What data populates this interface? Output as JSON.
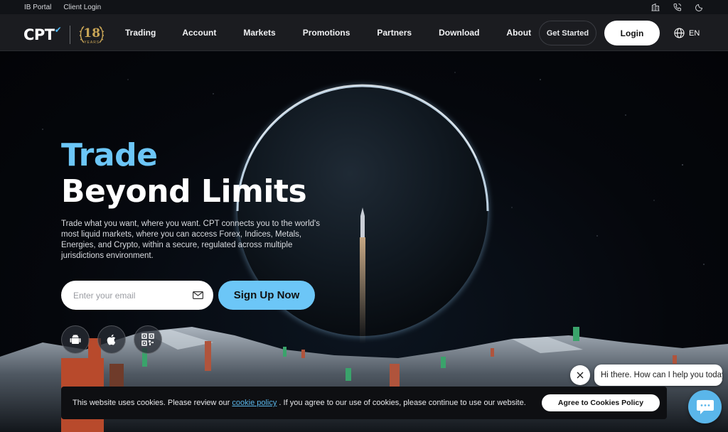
{
  "topbar": {
    "links": [
      "IB Portal",
      "Client Login"
    ],
    "icons": [
      "building-icon",
      "phone-icon",
      "moon-icon"
    ]
  },
  "nav": {
    "logo_text": "CPT",
    "anniversary_badge": "18",
    "anniversary_badge_caption": "YEARS",
    "menu": [
      "Trading",
      "Account",
      "Markets",
      "Promotions",
      "Partners",
      "Download",
      "About"
    ],
    "get_started": "Get Started",
    "login": "Login",
    "language": "EN"
  },
  "hero": {
    "title_line1": "Trade",
    "title_line2": "Beyond Limits",
    "description": "Trade what you want, where you want. CPT connects you to the world's most liquid markets, where you can access Forex, Indices, Metals, Energies, and Crypto, within a secure, regulated across multiple jurisdictions environment.",
    "email_placeholder": "Enter your email",
    "signup_label": "Sign Up Now",
    "app_buttons": [
      "android-icon",
      "apple-icon",
      "qr-code-icon"
    ]
  },
  "chat": {
    "greeting": "Hi there. How can I help you today?"
  },
  "cookie": {
    "text_before": "This website uses cookies. Please review our ",
    "link_text": "cookie policy",
    "text_after": " . If you agree to our use of cookies, please continue to use our website.",
    "button": "Agree to Cookies Policy"
  },
  "colors": {
    "accent": "#6cc6f7",
    "nav_bg": "#1b1c20",
    "topbar_bg": "#111317",
    "hero_bg": "#05070c"
  }
}
